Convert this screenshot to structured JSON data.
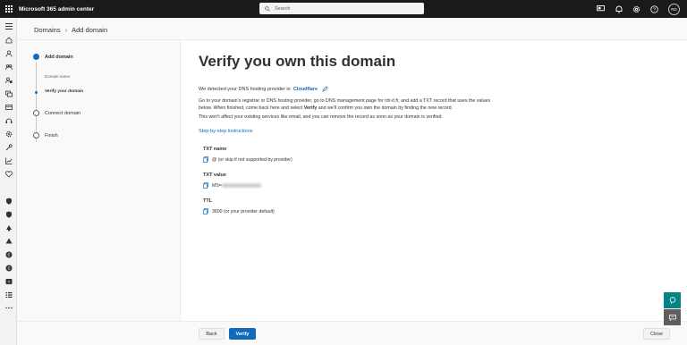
{
  "header": {
    "app_title": "Microsoft 365 admin center",
    "search_placeholder": "Search",
    "avatar_initials": "RD"
  },
  "breadcrumb": {
    "parent": "Domains",
    "current": "Add domain"
  },
  "wizard": {
    "steps": [
      {
        "label": "Add domain",
        "state": "active"
      },
      {
        "label": "Domain name",
        "state": "completed-substep"
      },
      {
        "label": "Verify your domain",
        "state": "current-substep"
      },
      {
        "label": "Connect domain",
        "state": "pending"
      },
      {
        "label": "Finish",
        "state": "pending"
      }
    ]
  },
  "main": {
    "title": "Verify you own this domain",
    "detected_prefix": "We detected your DNS hosting provider is:",
    "provider": "Cloudflare",
    "instructions_1": "Go to your domain's registrar or DNS hosting provider, go to DNS management page for rdr-it.fr, and add a TXT record that uses the values below. When finished, come back here and select",
    "instructions_verify": "Verify",
    "instructions_2": "and we'll confirm you own the domain by finding the new record.",
    "instructions_3": "This won't affect your existing services like email, and you can remove the record as soon as your domain is verified.",
    "step_by_step_link": "Step-by-step instructions",
    "records": {
      "txt_name_label": "TXT name",
      "txt_name_value": "@ (or skip if not supported by provider)",
      "txt_value_label": "TXT value",
      "txt_value_prefix": "MS=",
      "ttl_label": "TTL",
      "ttl_value": "3600 (or your provider default)"
    }
  },
  "footer": {
    "back_label": "Back",
    "verify_label": "Verify",
    "close_label": "Close"
  },
  "colors": {
    "accent": "#0f6cbd",
    "topbar": "#1b1a19",
    "fab": "#038387"
  }
}
